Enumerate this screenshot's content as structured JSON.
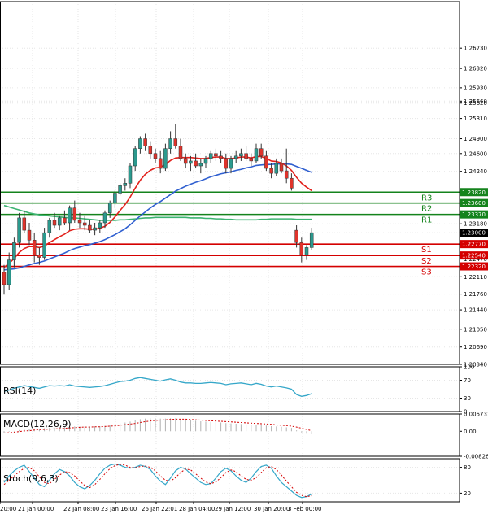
{
  "colors": {
    "up": "#2b9a8e",
    "down": "#e0332b",
    "resistance": "#14831c",
    "support": "#d40000",
    "price_tag": "#000000",
    "ma_fast": "#e2211c",
    "ma_mid": "#2f5fd0",
    "ma_slow": "#3cb371",
    "rsi": "#35a7c9",
    "macd_hist": "#b0b0b0",
    "macd_signal": "#d40000",
    "stoch_k": "#35a7c9",
    "stoch_d": "#d40000",
    "grid": "#e6e6e6"
  },
  "chart_data": [
    {
      "type": "candlestick",
      "ylim": [
        1.2034,
        1.2767
      ],
      "y_ticks": [
        "1.26730",
        "1.26320",
        "1.25930",
        "1.25620",
        "1.25660",
        "1.25310",
        "1.24900",
        "1.24600",
        "1.24240",
        "1.23820",
        "1.23600",
        "1.23370",
        "1.23180",
        "1.23000",
        "1.22770",
        "1.22540",
        "1.22470",
        "1.22320",
        "1.22110",
        "1.21760",
        "1.21440",
        "1.21050",
        "1.20690",
        "1.20340"
      ],
      "x_ticks": [
        "20:00",
        "21 Jan 00:00",
        "22 Jan 08:00",
        "23 Jan 16:00",
        "26 Jan 22:01",
        "28 Jan 04:00",
        "29 Jan 12:00",
        "30 Jan 20:00",
        "3 Feb 00:00"
      ],
      "levels": [
        {
          "name": "R3",
          "value": 1.2382,
          "label": "1.23820",
          "kind": "resistance"
        },
        {
          "name": "R2",
          "value": 1.236,
          "label": "1.23600",
          "kind": "resistance"
        },
        {
          "name": "R1",
          "value": 1.2337,
          "label": "1.23370",
          "kind": "resistance"
        },
        {
          "name": "S1",
          "value": 1.2277,
          "label": "1.22770",
          "kind": "support"
        },
        {
          "name": "S2",
          "value": 1.2254,
          "label": "1.22540",
          "kind": "support"
        },
        {
          "name": "S3",
          "value": 1.2232,
          "label": "1.22320",
          "kind": "support"
        }
      ],
      "current_price": {
        "value": 1.23,
        "label": "1.23000"
      },
      "candles": [
        [
          1.222,
          1.2235,
          1.2175,
          1.2195
        ],
        [
          1.2195,
          1.226,
          1.2185,
          1.2245
        ],
        [
          1.2245,
          1.229,
          1.223,
          1.228
        ],
        [
          1.228,
          1.234,
          1.227,
          1.233
        ],
        [
          1.233,
          1.2345,
          1.23,
          1.2305
        ],
        [
          1.2305,
          1.232,
          1.2275,
          1.2285
        ],
        [
          1.2285,
          1.23,
          1.224,
          1.2255
        ],
        [
          1.2255,
          1.227,
          1.2235,
          1.225
        ],
        [
          1.225,
          1.231,
          1.2245,
          1.23
        ],
        [
          1.23,
          1.233,
          1.229,
          1.2325
        ],
        [
          1.2325,
          1.234,
          1.231,
          1.2315
        ],
        [
          1.2315,
          1.2335,
          1.2305,
          1.233
        ],
        [
          1.233,
          1.2345,
          1.2315,
          1.232
        ],
        [
          1.232,
          1.2355,
          1.2305,
          1.235
        ],
        [
          1.235,
          1.2365,
          1.232,
          1.2325
        ],
        [
          1.2325,
          1.234,
          1.231,
          1.232
        ],
        [
          1.232,
          1.2335,
          1.2305,
          1.2315
        ],
        [
          1.2315,
          1.2325,
          1.23,
          1.2305
        ],
        [
          1.2305,
          1.232,
          1.2295,
          1.231
        ],
        [
          1.231,
          1.2325,
          1.23,
          1.232
        ],
        [
          1.232,
          1.2345,
          1.231,
          1.234
        ],
        [
          1.234,
          1.2365,
          1.233,
          1.236
        ],
        [
          1.236,
          1.2385,
          1.235,
          1.238
        ],
        [
          1.238,
          1.24,
          1.2375,
          1.2395
        ],
        [
          1.2395,
          1.241,
          1.2385,
          1.24
        ],
        [
          1.24,
          1.244,
          1.239,
          1.2435
        ],
        [
          1.2435,
          1.2475,
          1.2425,
          1.247
        ],
        [
          1.247,
          1.2495,
          1.246,
          1.249
        ],
        [
          1.249,
          1.25,
          1.2465,
          1.2475
        ],
        [
          1.2475,
          1.2485,
          1.245,
          1.246
        ],
        [
          1.246,
          1.247,
          1.244,
          1.245
        ],
        [
          1.245,
          1.2465,
          1.242,
          1.243
        ],
        [
          1.243,
          1.248,
          1.2425,
          1.247
        ],
        [
          1.247,
          1.2505,
          1.246,
          1.249
        ],
        [
          1.249,
          1.252,
          1.247,
          1.2475
        ],
        [
          1.2475,
          1.249,
          1.2445,
          1.245
        ],
        [
          1.245,
          1.246,
          1.243,
          1.244
        ],
        [
          1.244,
          1.2455,
          1.2425,
          1.2445
        ],
        [
          1.2445,
          1.246,
          1.243,
          1.2435
        ],
        [
          1.2435,
          1.245,
          1.242,
          1.244
        ],
        [
          1.244,
          1.2455,
          1.243,
          1.245
        ],
        [
          1.245,
          1.2465,
          1.244,
          1.246
        ],
        [
          1.246,
          1.247,
          1.2445,
          1.2455
        ],
        [
          1.2455,
          1.2465,
          1.244,
          1.245
        ],
        [
          1.245,
          1.246,
          1.242,
          1.243
        ],
        [
          1.243,
          1.2455,
          1.242,
          1.245
        ],
        [
          1.245,
          1.2465,
          1.244,
          1.2455
        ],
        [
          1.2455,
          1.247,
          1.2445,
          1.246
        ],
        [
          1.246,
          1.2475,
          1.2445,
          1.245
        ],
        [
          1.245,
          1.246,
          1.2435,
          1.2445
        ],
        [
          1.2445,
          1.248,
          1.244,
          1.247
        ],
        [
          1.247,
          1.248,
          1.245,
          1.2455
        ],
        [
          1.2455,
          1.2465,
          1.2425,
          1.243
        ],
        [
          1.243,
          1.244,
          1.241,
          1.242
        ],
        [
          1.242,
          1.245,
          1.2415,
          1.244
        ],
        [
          1.244,
          1.245,
          1.242,
          1.2425
        ],
        [
          1.2425,
          1.247,
          1.24,
          1.241
        ],
        [
          1.241,
          1.242,
          1.2385,
          1.239
        ],
        [
          1.2305,
          1.2315,
          1.227,
          1.228
        ],
        [
          1.228,
          1.229,
          1.224,
          1.2255
        ],
        [
          1.2255,
          1.2275,
          1.2245,
          1.227
        ],
        [
          1.227,
          1.231,
          1.2265,
          1.23
        ]
      ],
      "gap_after_index": 57,
      "ma_fast": [
        1.223,
        1.2238,
        1.2248,
        1.226,
        1.2268,
        1.2272,
        1.2272,
        1.227,
        1.2273,
        1.228,
        1.2286,
        1.2292,
        1.2297,
        1.2304,
        1.2307,
        1.2308,
        1.2308,
        1.2307,
        1.2307,
        1.2309,
        1.2313,
        1.2321,
        1.2332,
        1.2345,
        1.2357,
        1.2372,
        1.239,
        1.2406,
        1.2418,
        1.2426,
        1.2431,
        1.2432,
        1.2438,
        1.2446,
        1.2451,
        1.2452,
        1.2452,
        1.2452,
        1.2451,
        1.245,
        1.245,
        1.2452,
        1.2453,
        1.2453,
        1.245,
        1.245,
        1.2451,
        1.2453,
        1.2453,
        1.2451,
        1.2454,
        1.2454,
        1.245,
        1.2445,
        1.2444,
        1.2441,
        1.2435,
        1.2426,
        1.2412,
        1.24,
        1.2392,
        1.2385
      ],
      "ma_mid": [
        1.2225,
        1.2226,
        1.2227,
        1.2229,
        1.2232,
        1.2235,
        1.2238,
        1.224,
        1.2243,
        1.2247,
        1.2251,
        1.2255,
        1.2259,
        1.2264,
        1.2268,
        1.2271,
        1.2274,
        1.2276,
        1.2279,
        1.2282,
        1.2286,
        1.2291,
        1.2296,
        1.2302,
        1.2308,
        1.2316,
        1.2325,
        1.2334,
        1.2342,
        1.235,
        1.2357,
        1.2363,
        1.237,
        1.2377,
        1.2384,
        1.2389,
        1.2394,
        1.2398,
        1.2402,
        1.2405,
        1.2409,
        1.2413,
        1.2416,
        1.2419,
        1.2421,
        1.2423,
        1.2426,
        1.2428,
        1.2431,
        1.2433,
        1.2436,
        1.2437,
        1.2438,
        1.2438,
        1.2439,
        1.2439,
        1.2439,
        1.2438,
        1.2434,
        1.243,
        1.2426,
        1.2422
      ],
      "ma_slow": [
        1.2355,
        1.2352,
        1.2349,
        1.2346,
        1.2343,
        1.234,
        1.2338,
        1.2336,
        1.2335,
        1.2334,
        1.2333,
        1.2332,
        1.2331,
        1.233,
        1.233,
        1.2329,
        1.2328,
        1.2327,
        1.2326,
        1.2325,
        1.2325,
        1.2325,
        1.2325,
        1.2326,
        1.2326,
        1.2327,
        1.2328,
        1.2329,
        1.233,
        1.233,
        1.2331,
        1.2331,
        1.2331,
        1.2331,
        1.2331,
        1.2331,
        1.2331,
        1.233,
        1.233,
        1.233,
        1.2329,
        1.2329,
        1.2328,
        1.2328,
        1.2327,
        1.2327,
        1.2326,
        1.2326,
        1.2326,
        1.2326,
        1.2326,
        1.2327,
        1.2327,
        1.2328,
        1.2328,
        1.2328,
        1.2328,
        1.2328,
        1.2327,
        1.2327,
        1.2327,
        1.2327
      ]
    },
    {
      "type": "line",
      "title": "RSI(14)",
      "ylim": [
        0,
        100
      ],
      "y_ticks": [
        "100",
        "70",
        "30",
        "0"
      ],
      "values": [
        45,
        48,
        52,
        55,
        58,
        56,
        54,
        52,
        55,
        58,
        57,
        58,
        57,
        60,
        57,
        56,
        55,
        54,
        55,
        56,
        58,
        61,
        64,
        67,
        68,
        70,
        74,
        76,
        74,
        72,
        70,
        68,
        71,
        73,
        70,
        66,
        64,
        64,
        63,
        63,
        64,
        65,
        64,
        63,
        60,
        62,
        63,
        64,
        62,
        60,
        63,
        61,
        57,
        55,
        57,
        55,
        53,
        50,
        38,
        34,
        36,
        40
      ]
    },
    {
      "type": "bar",
      "title": "MACD(12,26,9)",
      "ylim": [
        -0.008266,
        0.005731
      ],
      "y_ticks": [
        "0.005731",
        "0.00",
        "-0.008266"
      ],
      "values": [
        -0.0005,
        -0.0002,
        0.0001,
        0.0004,
        0.0006,
        0.0008,
        0.0009,
        0.0009,
        0.001,
        0.0011,
        0.0012,
        0.0013,
        0.0014,
        0.0015,
        0.0016,
        0.0016,
        0.0016,
        0.0016,
        0.0016,
        0.0017,
        0.0018,
        0.002,
        0.0023,
        0.0026,
        0.0029,
        0.0032,
        0.0036,
        0.004,
        0.0042,
        0.0043,
        0.0043,
        0.0042,
        0.0042,
        0.0043,
        0.0043,
        0.0041,
        0.0039,
        0.0037,
        0.0035,
        0.0033,
        0.0032,
        0.0031,
        0.003,
        0.0029,
        0.0027,
        0.0026,
        0.0025,
        0.0024,
        0.0023,
        0.0022,
        0.0022,
        0.0021,
        0.0019,
        0.0017,
        0.0016,
        0.0015,
        0.0013,
        0.0011,
        0.0003,
        -0.0004,
        -0.0008,
        -0.001
      ],
      "signal": [
        -0.0006,
        -0.0005,
        -0.0003,
        -0.0001,
        0.0001,
        0.0002,
        0.0004,
        0.0005,
        0.0006,
        0.0007,
        0.0008,
        0.0009,
        0.001,
        0.0011,
        0.0012,
        0.0013,
        0.0014,
        0.0014,
        0.0015,
        0.0015,
        0.0016,
        0.0017,
        0.0018,
        0.002,
        0.0022,
        0.0024,
        0.0026,
        0.0029,
        0.0032,
        0.0034,
        0.0036,
        0.0037,
        0.0038,
        0.0039,
        0.004,
        0.004,
        0.004,
        0.0039,
        0.0038,
        0.0037,
        0.0036,
        0.0035,
        0.0034,
        0.0033,
        0.0032,
        0.0031,
        0.003,
        0.0029,
        0.0028,
        0.0027,
        0.0026,
        0.0025,
        0.0024,
        0.0023,
        0.0021,
        0.002,
        0.0019,
        0.0017,
        0.0014,
        0.001,
        0.0006,
        0.0002
      ]
    },
    {
      "type": "line",
      "title": "Stoch(9,6,3)",
      "ylim": [
        0,
        100
      ],
      "y_ticks": [
        "80",
        "20"
      ],
      "k": [
        45,
        60,
        72,
        80,
        85,
        70,
        55,
        40,
        35,
        50,
        65,
        75,
        70,
        60,
        45,
        35,
        30,
        38,
        50,
        65,
        78,
        85,
        88,
        85,
        80,
        78,
        80,
        85,
        82,
        75,
        60,
        48,
        40,
        55,
        72,
        80,
        76,
        65,
        55,
        45,
        40,
        42,
        55,
        70,
        78,
        72,
        60,
        50,
        45,
        55,
        70,
        82,
        85,
        78,
        60,
        45,
        35,
        25,
        15,
        10,
        12,
        18
      ],
      "d": [
        40,
        50,
        60,
        70,
        78,
        80,
        72,
        58,
        45,
        42,
        52,
        62,
        70,
        68,
        60,
        48,
        38,
        33,
        40,
        52,
        65,
        77,
        84,
        87,
        85,
        80,
        79,
        82,
        83,
        80,
        72,
        60,
        50,
        48,
        56,
        68,
        76,
        74,
        65,
        55,
        46,
        42,
        46,
        56,
        68,
        74,
        70,
        60,
        52,
        50,
        56,
        68,
        79,
        82,
        75,
        62,
        48,
        35,
        22,
        15,
        12,
        14
      ]
    }
  ],
  "indicator_labels": {
    "rsi": "RSI(14)",
    "macd": "MACD(12,26,9)",
    "stoch": "Stoch(9,6,3)"
  }
}
